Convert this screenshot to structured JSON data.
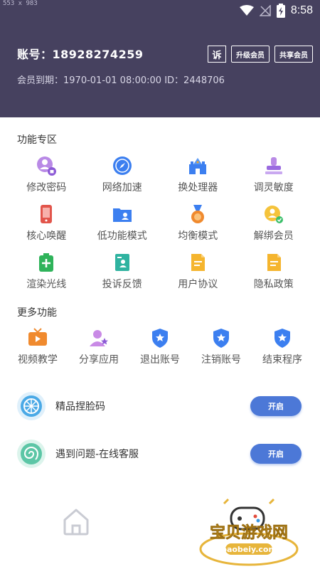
{
  "statusbar": {
    "dimensions_label": "553 x 983",
    "time": "8:58"
  },
  "header": {
    "account": "账号：18928274259",
    "expire": "会员到期：1970-01-01 08:00:00  ID：2448706",
    "sue_label": "诉",
    "upgrade_label": "升级会员",
    "share_label": "共享会员",
    "bg_color": "#46415f"
  },
  "features": {
    "title": "功能专区",
    "items": [
      {
        "label": "修改密码",
        "icon": "lock-person-icon"
      },
      {
        "label": "网络加速",
        "icon": "compass-icon"
      },
      {
        "label": "换处理器",
        "icon": "castle-icon"
      },
      {
        "label": "调灵敏度",
        "icon": "stamp-icon"
      },
      {
        "label": "核心唤醒",
        "icon": "phone-icon"
      },
      {
        "label": "低功能模式",
        "icon": "folder-user-icon"
      },
      {
        "label": "均衡模式",
        "icon": "medal-icon"
      },
      {
        "label": "解绑会员",
        "icon": "coin-person-icon"
      },
      {
        "label": "渲染光线",
        "icon": "battery-plus-icon"
      },
      {
        "label": "投诉反馈",
        "icon": "feedback-icon"
      },
      {
        "label": "用户协议",
        "icon": "document-icon"
      },
      {
        "label": "隐私政策",
        "icon": "document-icon"
      }
    ]
  },
  "more": {
    "title": "更多功能",
    "items": [
      {
        "label": "视频教学",
        "icon": "tv-icon"
      },
      {
        "label": "分享应用",
        "icon": "share-user-icon"
      },
      {
        "label": "退出账号",
        "icon": "shield-star-icon"
      },
      {
        "label": "注销账号",
        "icon": "shield-star-icon"
      },
      {
        "label": "结束程序",
        "icon": "shield-star-icon"
      }
    ]
  },
  "rows": [
    {
      "label": "精品捏脸码",
      "button": "开启",
      "icon": "wheel-icon"
    },
    {
      "label": "遇到问题-在线客服",
      "button": "开启",
      "icon": "spiral-icon"
    }
  ],
  "watermark": {
    "title": "宝贝游戏网",
    "url": "baobeiy.com"
  },
  "accent_color": "#4c78d7"
}
